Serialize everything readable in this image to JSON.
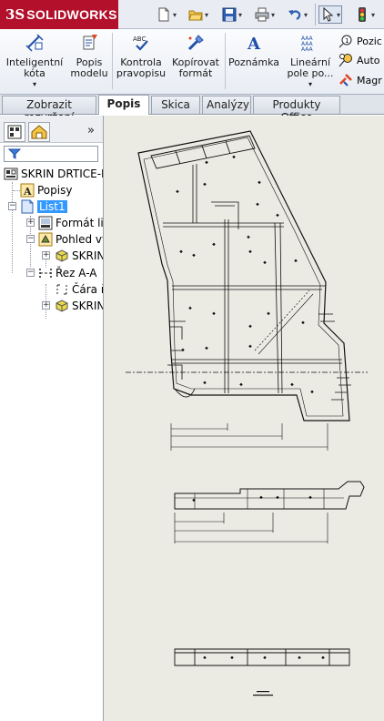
{
  "app": {
    "logo_prefix": "3S",
    "logo_name": "SOLIDWORKS"
  },
  "ribbon": {
    "smart_dimension": "Inteligentní kóta",
    "model_items": "Popis modelu",
    "spell_check": "Kontrola pravopisu",
    "format_painter": "Kopírovat formát",
    "note": "Poznámka",
    "linear_pattern": "Lineární pole po...",
    "balloon": "Pozic",
    "auto_balloon": "Auto",
    "magnetic_line": "Magr"
  },
  "tabs": [
    "Zobrazit rozvržení",
    "Popis",
    "Skica",
    "Analýzy",
    "Produkty Office"
  ],
  "active_tab": "Popis",
  "tree": {
    "root": "SKRIN DRTICE-P",
    "annotations": "Popisy",
    "sheet": "List1",
    "sheet_format": "Formát lis",
    "view": "Pohled vy",
    "part1": "SKRIN",
    "section": "Řez A-A",
    "section_line": "Čára ř",
    "part2": "SKRIN"
  },
  "colors": {
    "accent": "#b2102b",
    "selection": "#3399ff",
    "sheet_bg": "#ecebe3"
  },
  "icons": [
    "new-document-icon",
    "open-folder-icon",
    "save-icon",
    "print-icon",
    "undo-icon",
    "select-pointer-icon",
    "traffic-light-icon",
    "filter-icon",
    "feature-tree-icon",
    "property-manager-icon"
  ]
}
